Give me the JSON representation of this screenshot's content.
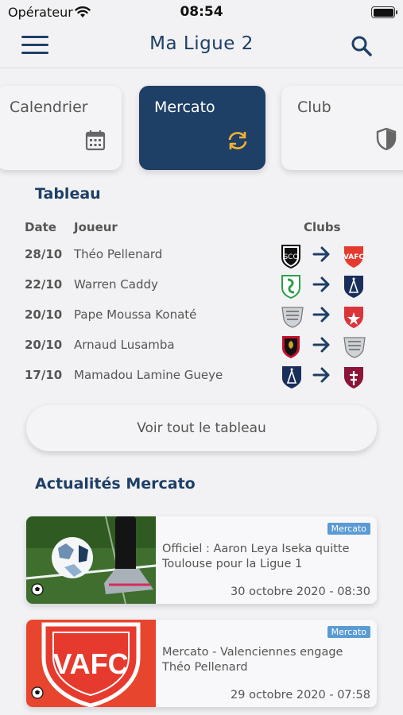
{
  "status_bar": {
    "carrier": "Opérateur",
    "time": "08:54"
  },
  "header": {
    "title": "Ma Ligue 2",
    "menu_icon": "menu-icon",
    "search_icon": "search-icon"
  },
  "tabs": [
    {
      "label": "Calendrier",
      "icon": "calendar-icon",
      "active": false
    },
    {
      "label": "Mercato",
      "icon": "refresh-icon",
      "active": true
    },
    {
      "label": "Club",
      "icon": "shield-icon",
      "active": false
    }
  ],
  "transfers": {
    "title": "Tableau",
    "columns": {
      "date": "Date",
      "player": "Joueur",
      "clubs": "Clubs"
    },
    "rows": [
      {
        "date": "28/10",
        "player": "Théo Pellenard",
        "from_crest": "angers-crest",
        "to_crest": "valenciennes-crest"
      },
      {
        "date": "22/10",
        "player": "Warren Caddy",
        "from_crest": "red-star-crest",
        "to_crest": "paris-fc-crest"
      },
      {
        "date": "20/10",
        "player": "Pape Moussa Konaté",
        "from_crest": "amiens-crest",
        "to_crest": "dijon-crest"
      },
      {
        "date": "20/10",
        "player": "Arnaud Lusamba",
        "from_crest": "nice-crest",
        "to_crest": "amiens-crest"
      },
      {
        "date": "17/10",
        "player": "Mamadou Lamine Gueye",
        "from_crest": "paris-fc-crest",
        "to_crest": "metz-crest"
      }
    ],
    "see_all_label": "Voir tout le tableau"
  },
  "news": {
    "title": "Actualités Mercato",
    "items": [
      {
        "tag": "Mercato",
        "headline": "Officiel : Aaron Leya Iseka quitte Toulouse pour la Ligue 1",
        "date": "30 octobre 2020 - 08:30",
        "thumb": "football-photo"
      },
      {
        "tag": "Mercato",
        "headline": "Mercato - Valenciennes engage Théo Pellenard",
        "date": "29 octobre 2020 - 07:58",
        "thumb": "vafc-logo",
        "thumb_text": "VAFC"
      }
    ]
  },
  "colors": {
    "primary": "#1e3f66",
    "accent": "#f2b233",
    "tag": "#5b9bd5",
    "background": "#f2f2f4"
  }
}
